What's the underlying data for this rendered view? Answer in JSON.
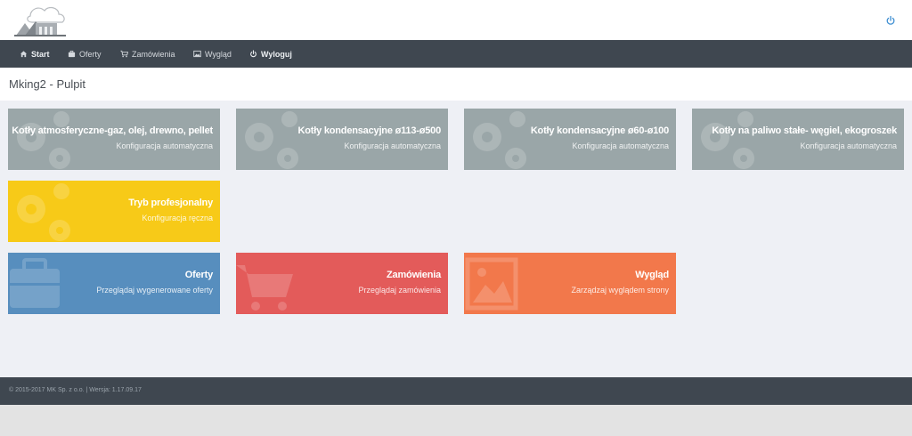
{
  "header": {
    "logo_icon": "mk-logo",
    "power_icon": "power-icon"
  },
  "nav": {
    "items": [
      {
        "label": "Start",
        "icon": "home-icon"
      },
      {
        "label": "Oferty",
        "icon": "briefcase-icon"
      },
      {
        "label": "Zamówienia",
        "icon": "cart-icon"
      },
      {
        "label": "Wygląd",
        "icon": "image-icon"
      },
      {
        "label": "Wyloguj",
        "icon": "power-icon"
      }
    ]
  },
  "page": {
    "title": "Mking2 - Pulpit"
  },
  "tiles": [
    {
      "title": "Kotły atmosferyczne-gaz, olej, drewno, pellet",
      "subtitle": "Konfiguracja automatyczna",
      "color": "#9aa6a8",
      "icon": "gears-icon"
    },
    {
      "title": "Kotły kondensacyjne ø113-ø500",
      "subtitle": "Konfiguracja automatyczna",
      "color": "#9aa6a8",
      "icon": "gears-icon"
    },
    {
      "title": "Kotły kondensacyjne ø60-ø100",
      "subtitle": "Konfiguracja automatyczna",
      "color": "#9aa6a8",
      "icon": "gears-icon"
    },
    {
      "title": "Kotły na paliwo stałe- węgiel, ekogroszek",
      "subtitle": "Konfiguracja automatyczna",
      "color": "#9aa6a8",
      "icon": "gears-icon"
    },
    {
      "title": "Tryb profesjonalny",
      "subtitle": "Konfiguracja ręczna",
      "color": "#f7ca18",
      "icon": "gears-icon"
    },
    {
      "title": "Oferty",
      "subtitle": "Przeglądaj wygenerowane oferty",
      "color": "#578ebe",
      "icon": "briefcase-icon"
    },
    {
      "title": "Zamówienia",
      "subtitle": "Przeglądaj zamówienia",
      "color": "#e35b5a",
      "icon": "cart-icon"
    },
    {
      "title": "Wygląd",
      "subtitle": "Zarządzaj wyglądem strony",
      "color": "#f2784b",
      "icon": "image-icon"
    }
  ],
  "footer": {
    "text": "© 2015-2017 MK Sp. z o.o. | Wersja: 1.17.09.17"
  }
}
